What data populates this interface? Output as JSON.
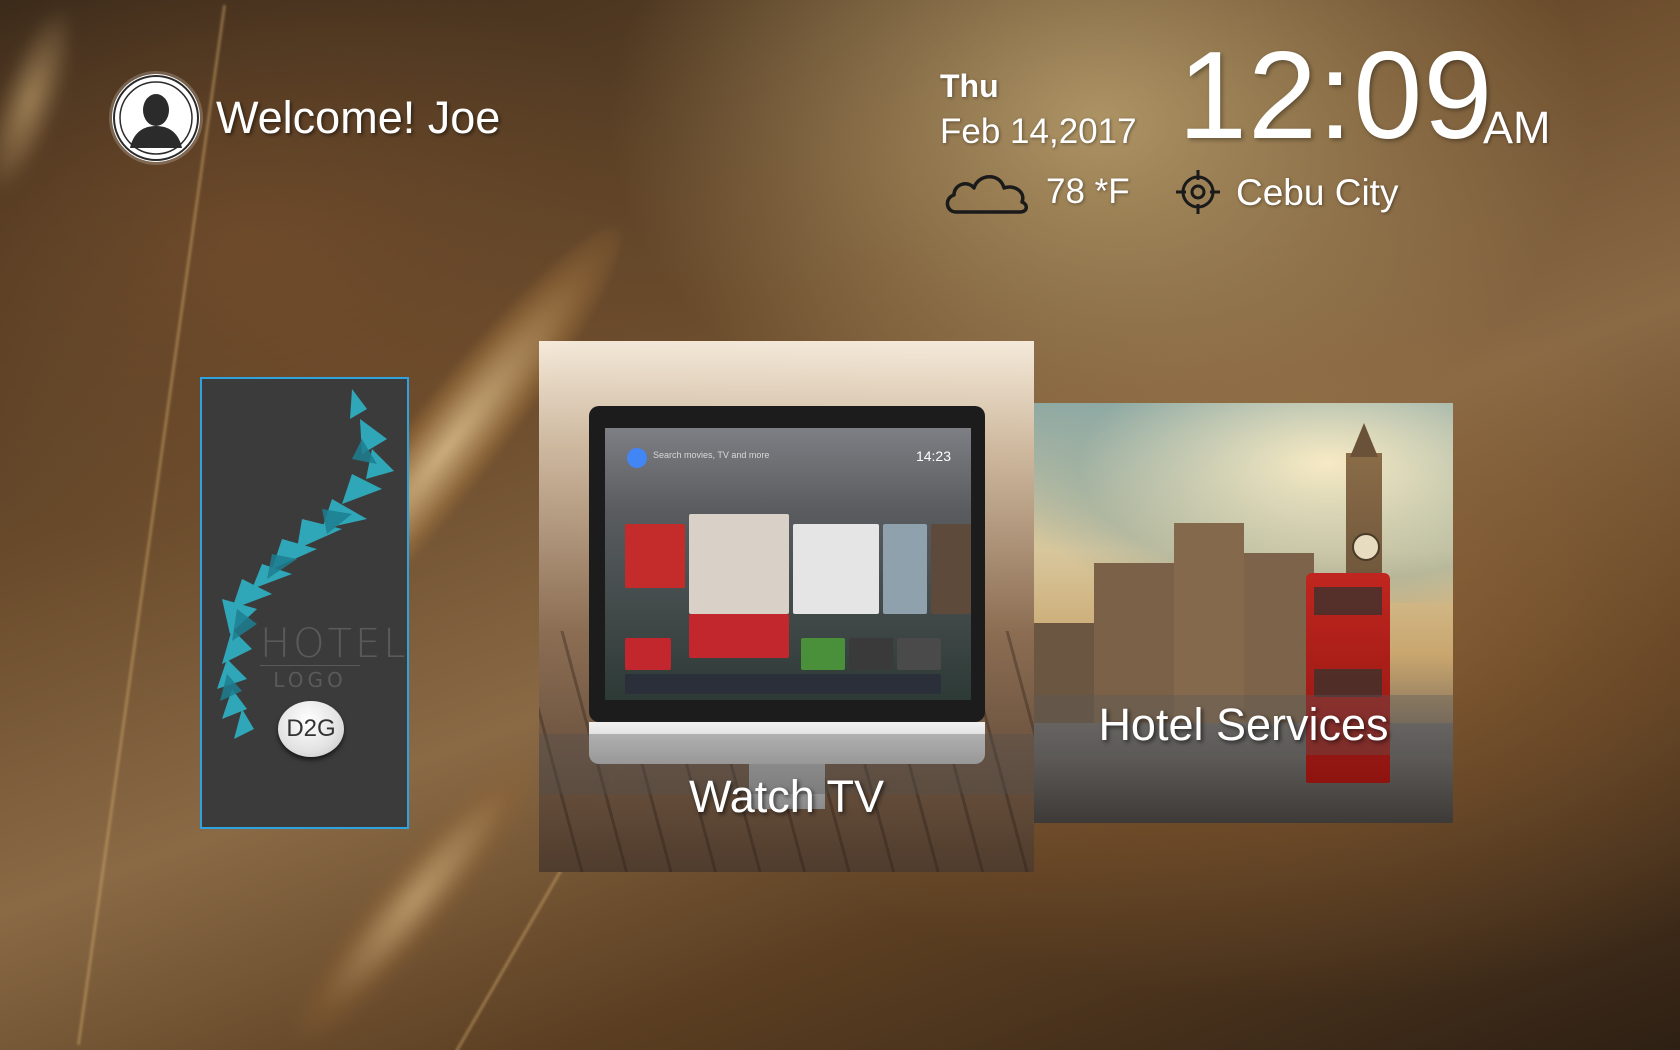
{
  "header": {
    "welcome": "Welcome! Joe",
    "avatar_icon": "user-avatar-icon"
  },
  "datetime": {
    "day": "Thu",
    "date": "Feb 14,2017",
    "time": "12:09",
    "ampm": "AM"
  },
  "weather": {
    "icon": "cloud-icon",
    "temperature": "78 *F",
    "location_icon": "location-target-icon",
    "city": "Cebu City"
  },
  "tiles": {
    "hotel": {
      "logo_word": "HOTEL",
      "logo_sub": "LOGO",
      "badge": "D2G",
      "border_color": "#2ea3e0"
    },
    "tv": {
      "label": "Watch TV",
      "screen": {
        "search_hint": "Search movies, TV and more",
        "clock": "14:23"
      }
    },
    "services": {
      "label": "Hotel Services"
    }
  }
}
